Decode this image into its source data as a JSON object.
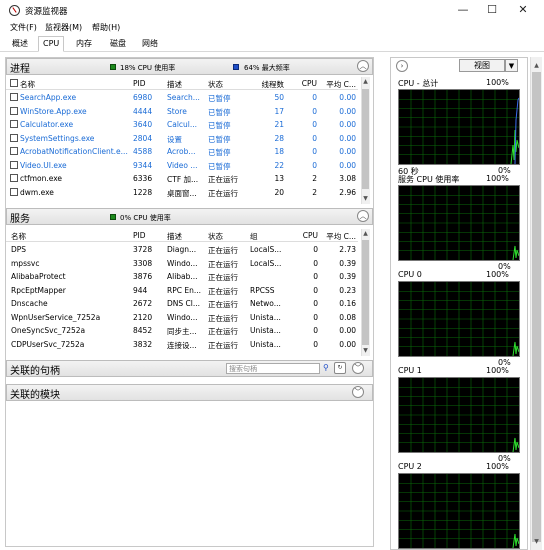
{
  "window": {
    "title": "资源监视器",
    "minimize": "—",
    "maximize": "☐",
    "close": "✕"
  },
  "menu": [
    "文件(F)",
    "监视器(M)",
    "帮助(H)"
  ],
  "tabs": [
    "概述",
    "CPU",
    "内存",
    "磁盘",
    "网络"
  ],
  "active_tab": "CPU",
  "processes": {
    "title": "进程",
    "legend1": "18% CPU 使用率",
    "legend2": "64% 最大频率",
    "columns": [
      "名称",
      "PID",
      "描述",
      "状态",
      "线程数",
      "CPU",
      "平均 C..."
    ],
    "rows": [
      {
        "name": "SearchApp.exe",
        "pid": "6980",
        "desc": "Search...",
        "status": "已暂停",
        "threads": "50",
        "cpu": "0",
        "avg": "0.00",
        "blue": true
      },
      {
        "name": "WinStore.App.exe",
        "pid": "4444",
        "desc": "Store",
        "status": "已暂停",
        "threads": "17",
        "cpu": "0",
        "avg": "0.00",
        "blue": true
      },
      {
        "name": "Calculator.exe",
        "pid": "3640",
        "desc": "Calcul...",
        "status": "已暂停",
        "threads": "21",
        "cpu": "0",
        "avg": "0.00",
        "blue": true
      },
      {
        "name": "SystemSettings.exe",
        "pid": "2804",
        "desc": "设置",
        "status": "已暂停",
        "threads": "28",
        "cpu": "0",
        "avg": "0.00",
        "blue": true
      },
      {
        "name": "AcrobatNotificationClient.e...",
        "pid": "4588",
        "desc": "Acrob...",
        "status": "已暂停",
        "threads": "18",
        "cpu": "0",
        "avg": "0.00",
        "blue": true
      },
      {
        "name": "Video.UI.exe",
        "pid": "9344",
        "desc": "Video ...",
        "status": "已暂停",
        "threads": "22",
        "cpu": "0",
        "avg": "0.00",
        "blue": true
      },
      {
        "name": "ctfmon.exe",
        "pid": "6336",
        "desc": "CTF 加...",
        "status": "正在运行",
        "threads": "13",
        "cpu": "2",
        "avg": "3.08",
        "blue": false
      },
      {
        "name": "dwm.exe",
        "pid": "1228",
        "desc": "桌面窗...",
        "status": "正在运行",
        "threads": "20",
        "cpu": "2",
        "avg": "2.96",
        "blue": false
      }
    ]
  },
  "services": {
    "title": "服务",
    "legend": "0% CPU 使用率",
    "columns": [
      "名称",
      "PID",
      "描述",
      "状态",
      "组",
      "CPU",
      "平均 C..."
    ],
    "rows": [
      {
        "name": "DPS",
        "pid": "3728",
        "desc": "Diagn...",
        "status": "正在运行",
        "group": "LocalS...",
        "cpu": "0",
        "avg": "2.73"
      },
      {
        "name": "mpssvc",
        "pid": "3308",
        "desc": "Windo...",
        "status": "正在运行",
        "group": "LocalS...",
        "cpu": "0",
        "avg": "0.39"
      },
      {
        "name": "AlibabaProtect",
        "pid": "3876",
        "desc": "Alibab...",
        "status": "正在运行",
        "group": "",
        "cpu": "0",
        "avg": "0.39"
      },
      {
        "name": "RpcEptMapper",
        "pid": "944",
        "desc": "RPC En...",
        "status": "正在运行",
        "group": "RPCSS",
        "cpu": "0",
        "avg": "0.23"
      },
      {
        "name": "Dnscache",
        "pid": "2672",
        "desc": "DNS Cl...",
        "status": "正在运行",
        "group": "Netwo...",
        "cpu": "0",
        "avg": "0.16"
      },
      {
        "name": "WpnUserService_7252a",
        "pid": "2120",
        "desc": "Windo...",
        "status": "正在运行",
        "group": "Unista...",
        "cpu": "0",
        "avg": "0.08"
      },
      {
        "name": "OneSyncSvc_7252a",
        "pid": "8452",
        "desc": "同步主...",
        "status": "正在运行",
        "group": "Unista...",
        "cpu": "0",
        "avg": "0.00"
      },
      {
        "name": "CDPUserSvc_7252a",
        "pid": "3832",
        "desc": "连接设...",
        "status": "正在运行",
        "group": "Unista...",
        "cpu": "0",
        "avg": "0.00"
      }
    ]
  },
  "handles": {
    "title": "关联的句柄",
    "search_placeholder": "搜索句柄"
  },
  "modules": {
    "title": "关联的模块"
  },
  "right": {
    "view_label": "视图",
    "graphs": [
      {
        "title": "CPU - 总计",
        "top": "100%",
        "bottom_left": "60 秒",
        "bottom_right": "0%"
      },
      {
        "title": "服务 CPU 使用率",
        "top": "100%",
        "bottom_left": "",
        "bottom_right": "0%"
      },
      {
        "title": "CPU 0",
        "top": "100%",
        "bottom_left": "",
        "bottom_right": "0%"
      },
      {
        "title": "CPU 1",
        "top": "100%",
        "bottom_left": "",
        "bottom_right": "0%"
      },
      {
        "title": "CPU 2",
        "top": "100%",
        "bottom_left": "",
        "bottom_right": ""
      }
    ]
  },
  "colors": {
    "link_blue": "#1a6bd6",
    "legend_green": "#1c8a1c",
    "legend_blue": "#1f4ec8",
    "graph_grid": "#0a6a0a"
  }
}
